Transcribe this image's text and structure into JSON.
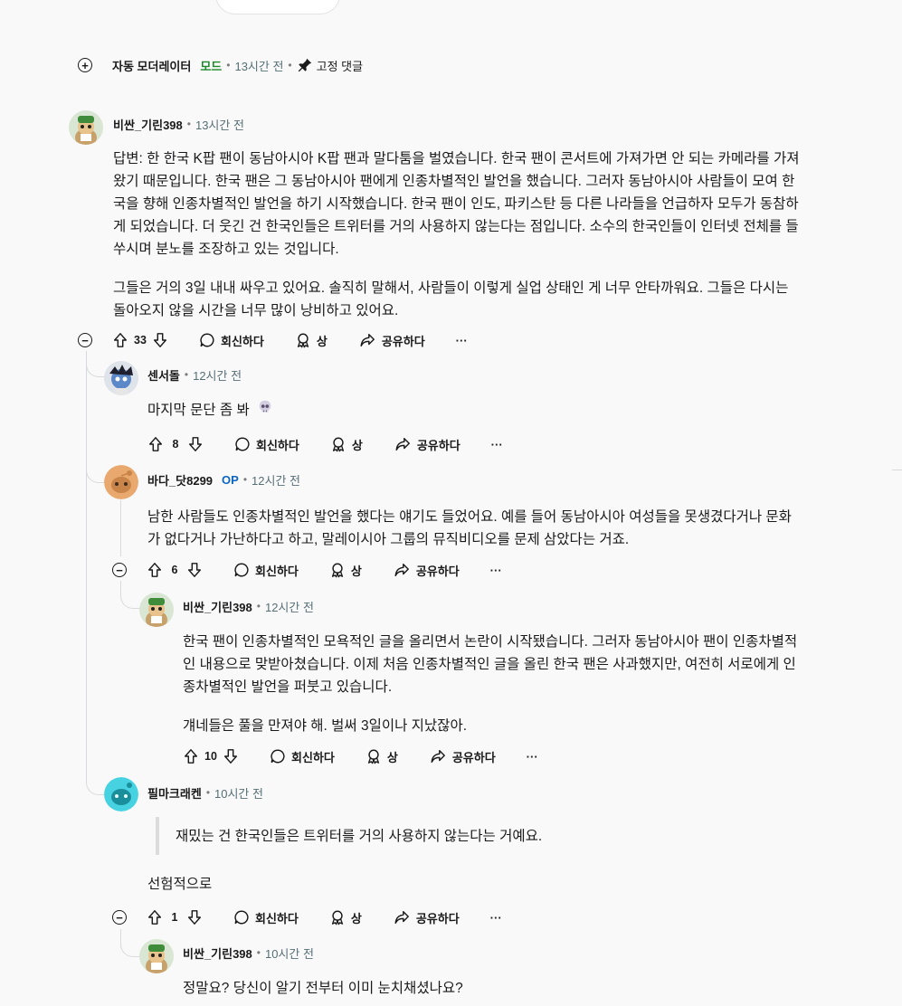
{
  "automod": {
    "author": "자동 모더레이터",
    "badge": "모드",
    "time": "13시간 전",
    "pinned_label": "고정 댓글"
  },
  "actions": {
    "reply": "회신하다",
    "award": "상",
    "share": "공유하다",
    "more": "···"
  },
  "comments": [
    {
      "author": "비싼_기린398",
      "time": "13시간 전",
      "paragraphs": [
        "답변: 한 한국 K팝 팬이 동남아시아 K팝 팬과 말다툼을 벌였습니다. 한국 팬이 콘서트에 가져가면 안 되는 카메라를 가져",
        "왔기 때문입니다. 한국 팬은 그 동남아시아 팬에게 인종차별적인 발언을 했습니다. 그러자 동남아시아 사람들이 모여 한",
        "국을 향해 인종차별적인 발언을 하기 시작했습니다. 한국 팬이 인도, 파키스탄 등 다른 나라들을 언급하자 모두가 동참하",
        "게 되었습니다. 더 웃긴 건 한국인들은 트위터를 거의 사용하지 않는다는 점입니다. 소수의 한국인들이 인터넷 전체를 들",
        "쑤시며 분노를 조장하고 있는 것입니다."
      ],
      "paragraph2": [
        "그들은 거의 3일 내내 싸우고 있어요. 솔직히 말해서, 사람들이 이렇게 실업 상태인 게 너무 안타까워요. 그들은 다시는",
        "돌아오지 않을 시간을 너무 많이 낭비하고 있어요."
      ],
      "votes": "33"
    },
    {
      "author": "센서돌",
      "time": "12시간 전",
      "text": "마지막 문단 좀 봐",
      "votes": "8"
    },
    {
      "author": "바다_닷8299",
      "op": "OP",
      "time": "12시간 전",
      "lines": [
        "남한 사람들도 인종차별적인 발언을 했다는 얘기도 들었어요. 예를 들어 동남아시아 여성들을 못생겼다거나 문화",
        "가 없다거나 가난하다고 하고, 말레이시아 그룹의 뮤직비디오를 문제 삼았다는 거죠."
      ],
      "votes": "6"
    },
    {
      "author": "비싼_기린398",
      "time": "12시간 전",
      "lines": [
        "한국 팬이 인종차별적인 모욕적인 글을 올리면서 논란이 시작됐습니다. 그러자 동남아시아 팬이 인종차별적",
        "인 내용으로 맞받아쳤습니다. 이제 처음 인종차별적인 글을 올린 한국 팬은 사과했지만, 여전히 서로에게 인",
        "종차별적인 발언을 퍼붓고 있습니다."
      ],
      "line2": "걔네들은 풀을 만져야 해. 벌써 3일이나 지났잖아.",
      "votes": "10"
    },
    {
      "author": "필마크래켄",
      "time": "10시간 전",
      "quote": "재밌는 건 한국인들은 트위터를 거의 사용하지 않는다는 거예요.",
      "text": "선험적으로",
      "votes": "1"
    },
    {
      "author": "비싼_기린398",
      "time": "10시간 전",
      "text": "정말요? 당신이 알기 전부터 이미 눈치채셨나요?"
    }
  ]
}
